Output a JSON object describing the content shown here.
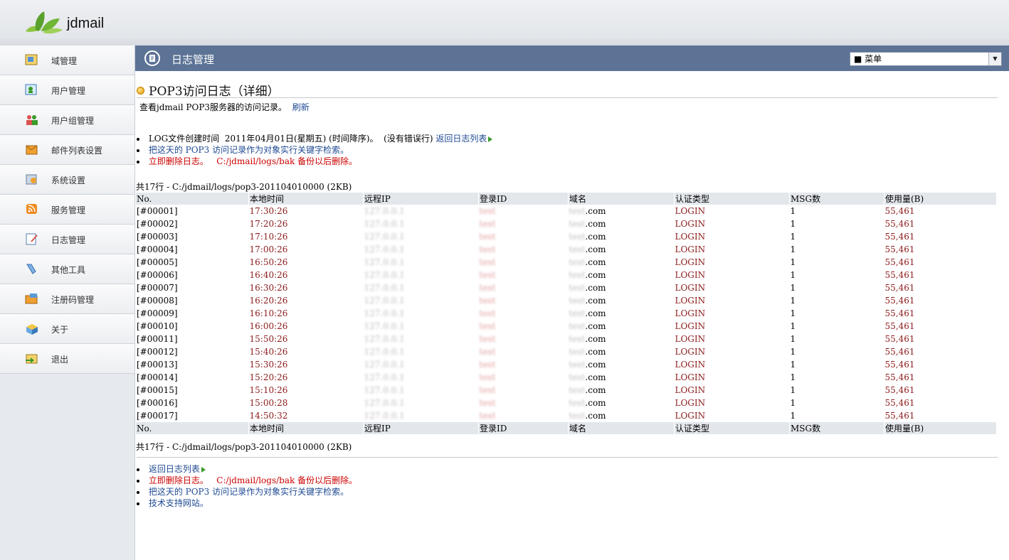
{
  "app": {
    "brand": "jdmail"
  },
  "sidebar": {
    "items": [
      {
        "label": "域管理",
        "icon": "domain-icon"
      },
      {
        "label": "用户管理",
        "icon": "user-icon"
      },
      {
        "label": "用户组管理",
        "icon": "group-icon"
      },
      {
        "label": "邮件列表设置",
        "icon": "mailinglist-icon"
      },
      {
        "label": "系统设置",
        "icon": "settings-icon"
      },
      {
        "label": "服务管理",
        "icon": "service-icon"
      },
      {
        "label": "日志管理",
        "icon": "log-icon"
      },
      {
        "label": "其他工具",
        "icon": "tools-icon"
      },
      {
        "label": "注册码管理",
        "icon": "license-icon"
      },
      {
        "label": "关于",
        "icon": "about-icon"
      },
      {
        "label": "退出",
        "icon": "logout-icon"
      }
    ]
  },
  "header": {
    "title": "日志管理",
    "menu_value": "■ 菜单"
  },
  "section": {
    "title": "POP3访问日志（详细）"
  },
  "description": {
    "text": "查看jdmail POP3服务器的访问记录。",
    "refresh": "刷新"
  },
  "info": {
    "created_prefix": "LOG文件创建时间",
    "created_date": "2011年04月01日(星期五) (时间降序)。",
    "no_error": "(没有错误行)",
    "back_link": "返回日志列表",
    "search_link": "把这天的 POP3 访问记录作为对象实行关键字检索。",
    "delete_now": "立即删除日志。",
    "delete_note": "C:/jdmail/logs/bak 备份以后删除。"
  },
  "summary": {
    "count": "共17行",
    "path": " - C:/jdmail/logs/pop3-201104010000 (2KB)"
  },
  "table": {
    "columns": [
      "No.",
      "本地时间",
      "远程IP",
      "登录ID",
      "域名",
      "认证类型",
      "MSG数",
      "使用量(B)"
    ],
    "rows": [
      {
        "no": "[#00001]",
        "time": "17:30:26",
        "ip": "127.0.0.1",
        "id": "test",
        "domain": "test",
        "tld": ".com",
        "auth": "LOGIN",
        "msg": "1",
        "usage": "55,461"
      },
      {
        "no": "[#00002]",
        "time": "17:20:26",
        "ip": "127.0.0.1",
        "id": "test",
        "domain": "test",
        "tld": ".com",
        "auth": "LOGIN",
        "msg": "1",
        "usage": "55,461"
      },
      {
        "no": "[#00003]",
        "time": "17:10:26",
        "ip": "127.0.0.1",
        "id": "test",
        "domain": "test",
        "tld": ".com",
        "auth": "LOGIN",
        "msg": "1",
        "usage": "55,461"
      },
      {
        "no": "[#00004]",
        "time": "17:00:26",
        "ip": "127.0.0.1",
        "id": "test",
        "domain": "test",
        "tld": ".com",
        "auth": "LOGIN",
        "msg": "1",
        "usage": "55,461"
      },
      {
        "no": "[#00005]",
        "time": "16:50:26",
        "ip": "127.0.0.1",
        "id": "test",
        "domain": "test",
        "tld": ".com",
        "auth": "LOGIN",
        "msg": "1",
        "usage": "55,461"
      },
      {
        "no": "[#00006]",
        "time": "16:40:26",
        "ip": "127.0.0.1",
        "id": "test",
        "domain": "test",
        "tld": ".com",
        "auth": "LOGIN",
        "msg": "1",
        "usage": "55,461"
      },
      {
        "no": "[#00007]",
        "time": "16:30:26",
        "ip": "127.0.0.1",
        "id": "test",
        "domain": "test",
        "tld": ".com",
        "auth": "LOGIN",
        "msg": "1",
        "usage": "55,461"
      },
      {
        "no": "[#00008]",
        "time": "16:20:26",
        "ip": "127.0.0.1",
        "id": "test",
        "domain": "test",
        "tld": ".com",
        "auth": "LOGIN",
        "msg": "1",
        "usage": "55,461"
      },
      {
        "no": "[#00009]",
        "time": "16:10:26",
        "ip": "127.0.0.1",
        "id": "test",
        "domain": "test",
        "tld": ".com",
        "auth": "LOGIN",
        "msg": "1",
        "usage": "55,461"
      },
      {
        "no": "[#00010]",
        "time": "16:00:26",
        "ip": "127.0.0.1",
        "id": "test",
        "domain": "test",
        "tld": ".com",
        "auth": "LOGIN",
        "msg": "1",
        "usage": "55,461"
      },
      {
        "no": "[#00011]",
        "time": "15:50:26",
        "ip": "127.0.0.1",
        "id": "test",
        "domain": "test",
        "tld": ".com",
        "auth": "LOGIN",
        "msg": "1",
        "usage": "55,461"
      },
      {
        "no": "[#00012]",
        "time": "15:40:26",
        "ip": "127.0.0.1",
        "id": "test",
        "domain": "test",
        "tld": ".com",
        "auth": "LOGIN",
        "msg": "1",
        "usage": "55,461"
      },
      {
        "no": "[#00013]",
        "time": "15:30:26",
        "ip": "127.0.0.1",
        "id": "test",
        "domain": "test",
        "tld": ".com",
        "auth": "LOGIN",
        "msg": "1",
        "usage": "55,461"
      },
      {
        "no": "[#00014]",
        "time": "15:20:26",
        "ip": "127.0.0.1",
        "id": "test",
        "domain": "test",
        "tld": ".com",
        "auth": "LOGIN",
        "msg": "1",
        "usage": "55,461"
      },
      {
        "no": "[#00015]",
        "time": "15:10:26",
        "ip": "127.0.0.1",
        "id": "test",
        "domain": "test",
        "tld": ".com",
        "auth": "LOGIN",
        "msg": "1",
        "usage": "55,461"
      },
      {
        "no": "[#00016]",
        "time": "15:00:28",
        "ip": "127.0.0.1",
        "id": "test",
        "domain": "test",
        "tld": ".com",
        "auth": "LOGIN",
        "msg": "1",
        "usage": "55,461"
      },
      {
        "no": "[#00017]",
        "time": "14:50:32",
        "ip": "127.0.0.1",
        "id": "test",
        "domain": "test",
        "tld": ".com",
        "auth": "LOGIN",
        "msg": "1",
        "usage": "55,461"
      }
    ]
  },
  "footer_links": {
    "back": "返回日志列表",
    "delete_now": "立即删除日志。",
    "delete_note": "C:/jdmail/logs/bak 备份以后删除。",
    "search": "把这天的 POP3 访问记录作为对象实行关键字检索。",
    "support": "技术支持网站。"
  },
  "colors": {
    "header_bg": "#5c7396",
    "sidebar_bg": "#e6e9ed",
    "link": "#1f4a93",
    "danger": "#cc0000",
    "cell_red": "#8b1a1a"
  }
}
